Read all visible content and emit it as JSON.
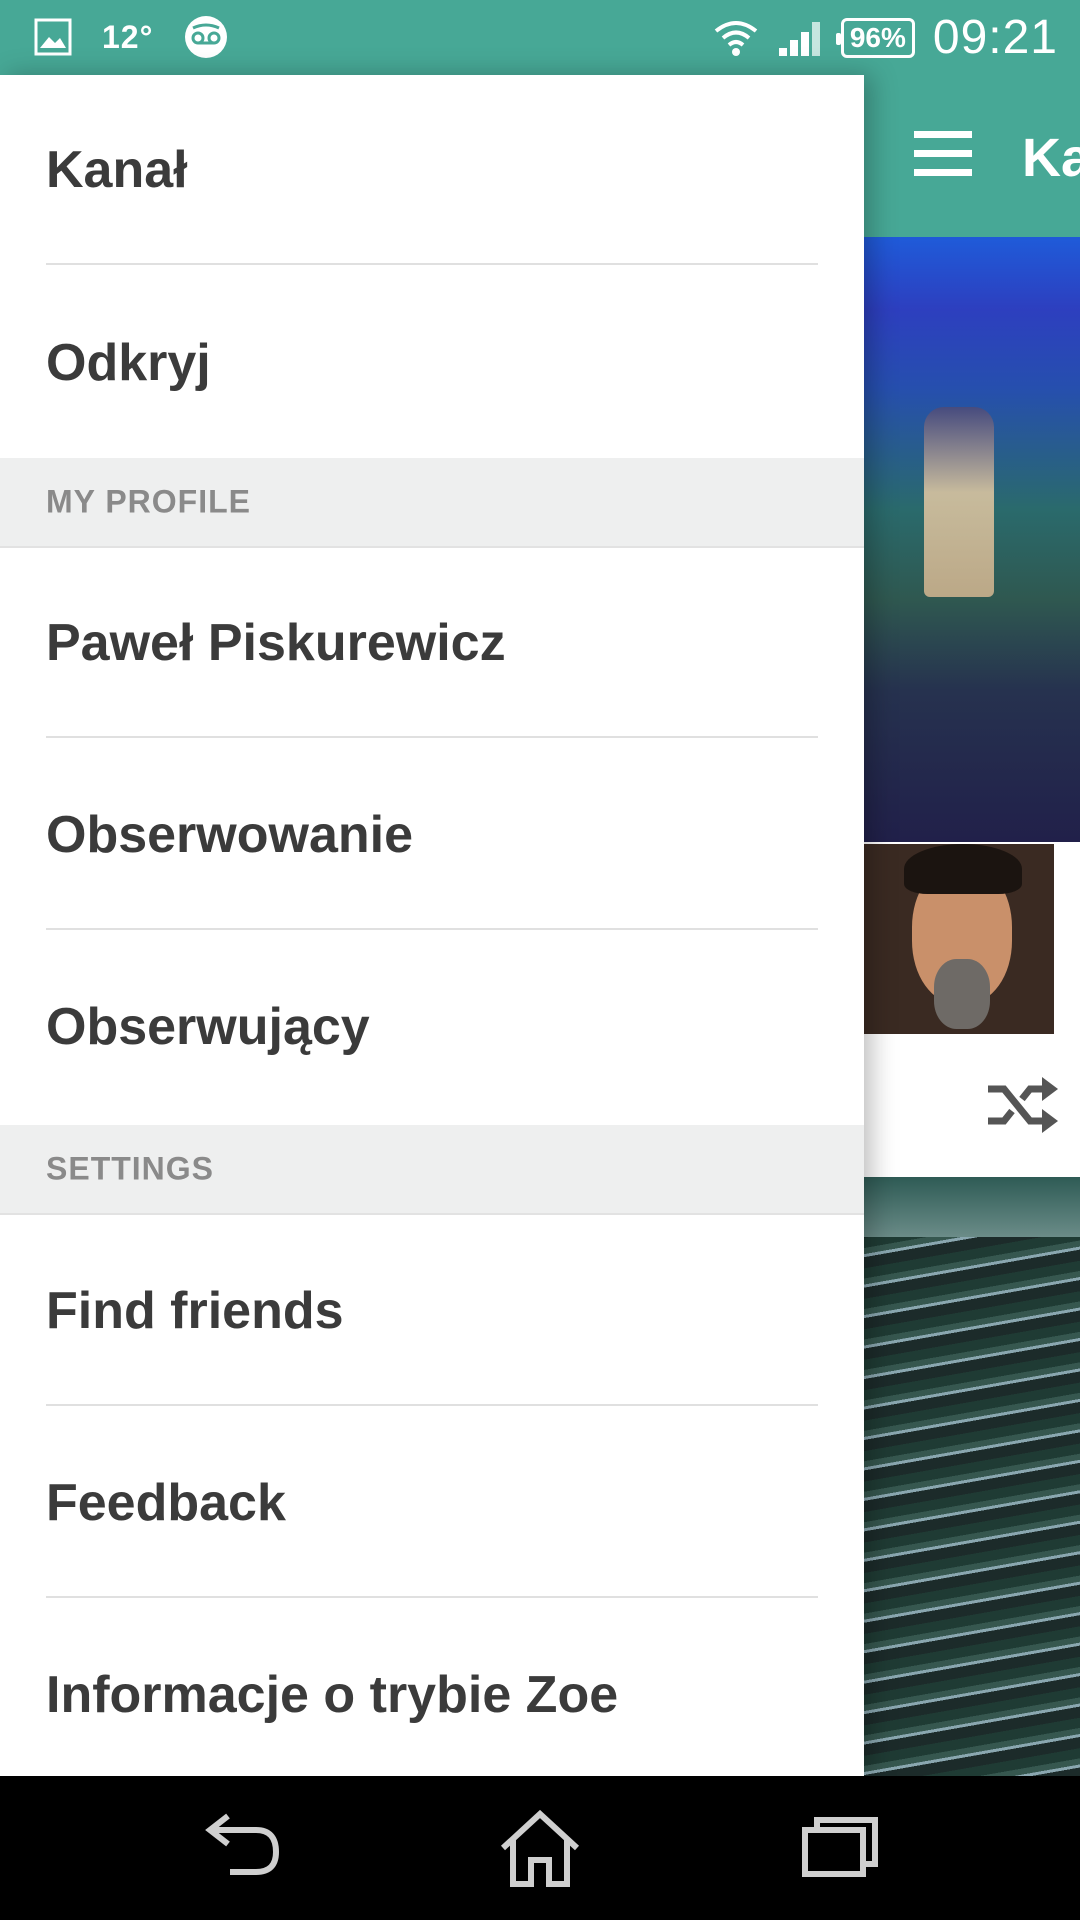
{
  "status_bar": {
    "temperature": "12°",
    "battery": "96%",
    "time": "09:21",
    "icons": [
      "gallery-icon",
      "voicemail-icon",
      "wifi-icon",
      "signal-icon",
      "battery-icon"
    ]
  },
  "main": {
    "appbar_title": "Kanał",
    "icons": [
      "menu-icon",
      "shuffle-icon"
    ]
  },
  "drawer": {
    "items_top": [
      "Kanał",
      "Odkryj"
    ],
    "section_profile": "MY PROFILE",
    "items_profile": [
      "Paweł Piskurewicz",
      "Obserwowanie",
      "Obserwujący"
    ],
    "section_settings": "SETTINGS",
    "items_settings": [
      "Find friends",
      "Feedback",
      "Informacje o trybie Zoe"
    ]
  },
  "colors": {
    "accent": "#47a896",
    "text": "#3b3b3b",
    "section_bg": "#eeefef",
    "section_text": "#8a8a8a"
  },
  "navbar": {
    "icons": [
      "back-icon",
      "home-icon",
      "recent-apps-icon"
    ]
  }
}
